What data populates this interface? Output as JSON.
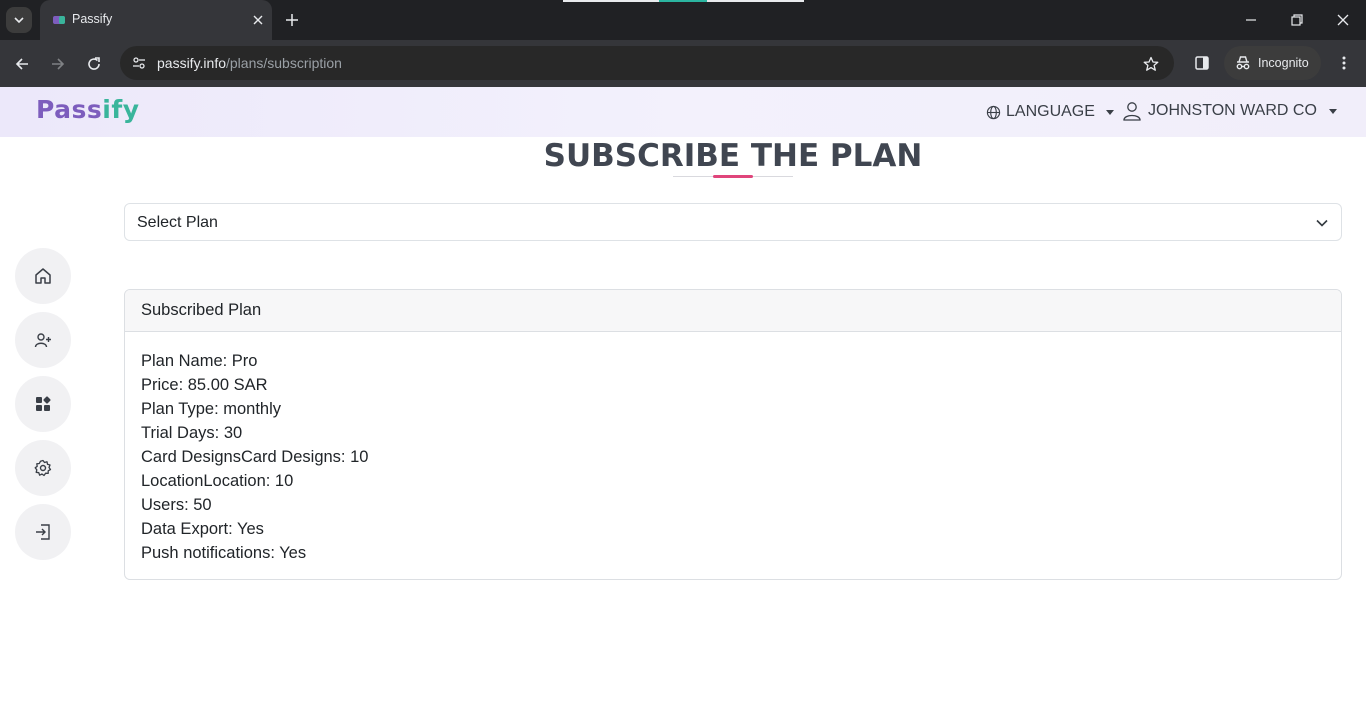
{
  "browser": {
    "tab_title": "Passify",
    "url_host": "passify.info",
    "url_path": "/plans/subscription",
    "incognito_label": "Incognito"
  },
  "header": {
    "logo_part1": "Pass",
    "logo_part2": "ify",
    "language_label": "LANGUAGE",
    "user_label": "JOHNSTON WARD CO"
  },
  "sidebar": {
    "items": [
      {
        "icon": "home-icon"
      },
      {
        "icon": "add-user-icon"
      },
      {
        "icon": "dashboard-icon"
      },
      {
        "icon": "settings-icon"
      },
      {
        "icon": "logout-icon"
      }
    ]
  },
  "main": {
    "title": "SUBSCRIBE THE PLAN",
    "select": {
      "value": "Select Plan"
    },
    "card": {
      "header": "Subscribed Plan",
      "lines": [
        "Plan Name: Pro",
        "Price: 85.00 SAR",
        "Plan Type: monthly",
        "Trial Days: 30",
        "Card DesignsCard Designs: 10",
        "LocationLocation: 10",
        "Users: 50",
        "Data Export: Yes",
        "Push notifications: Yes"
      ]
    }
  },
  "colors": {
    "title_accent": "#e0457b",
    "logo_purple": "#7d5dbd",
    "logo_teal": "#39b59b"
  }
}
